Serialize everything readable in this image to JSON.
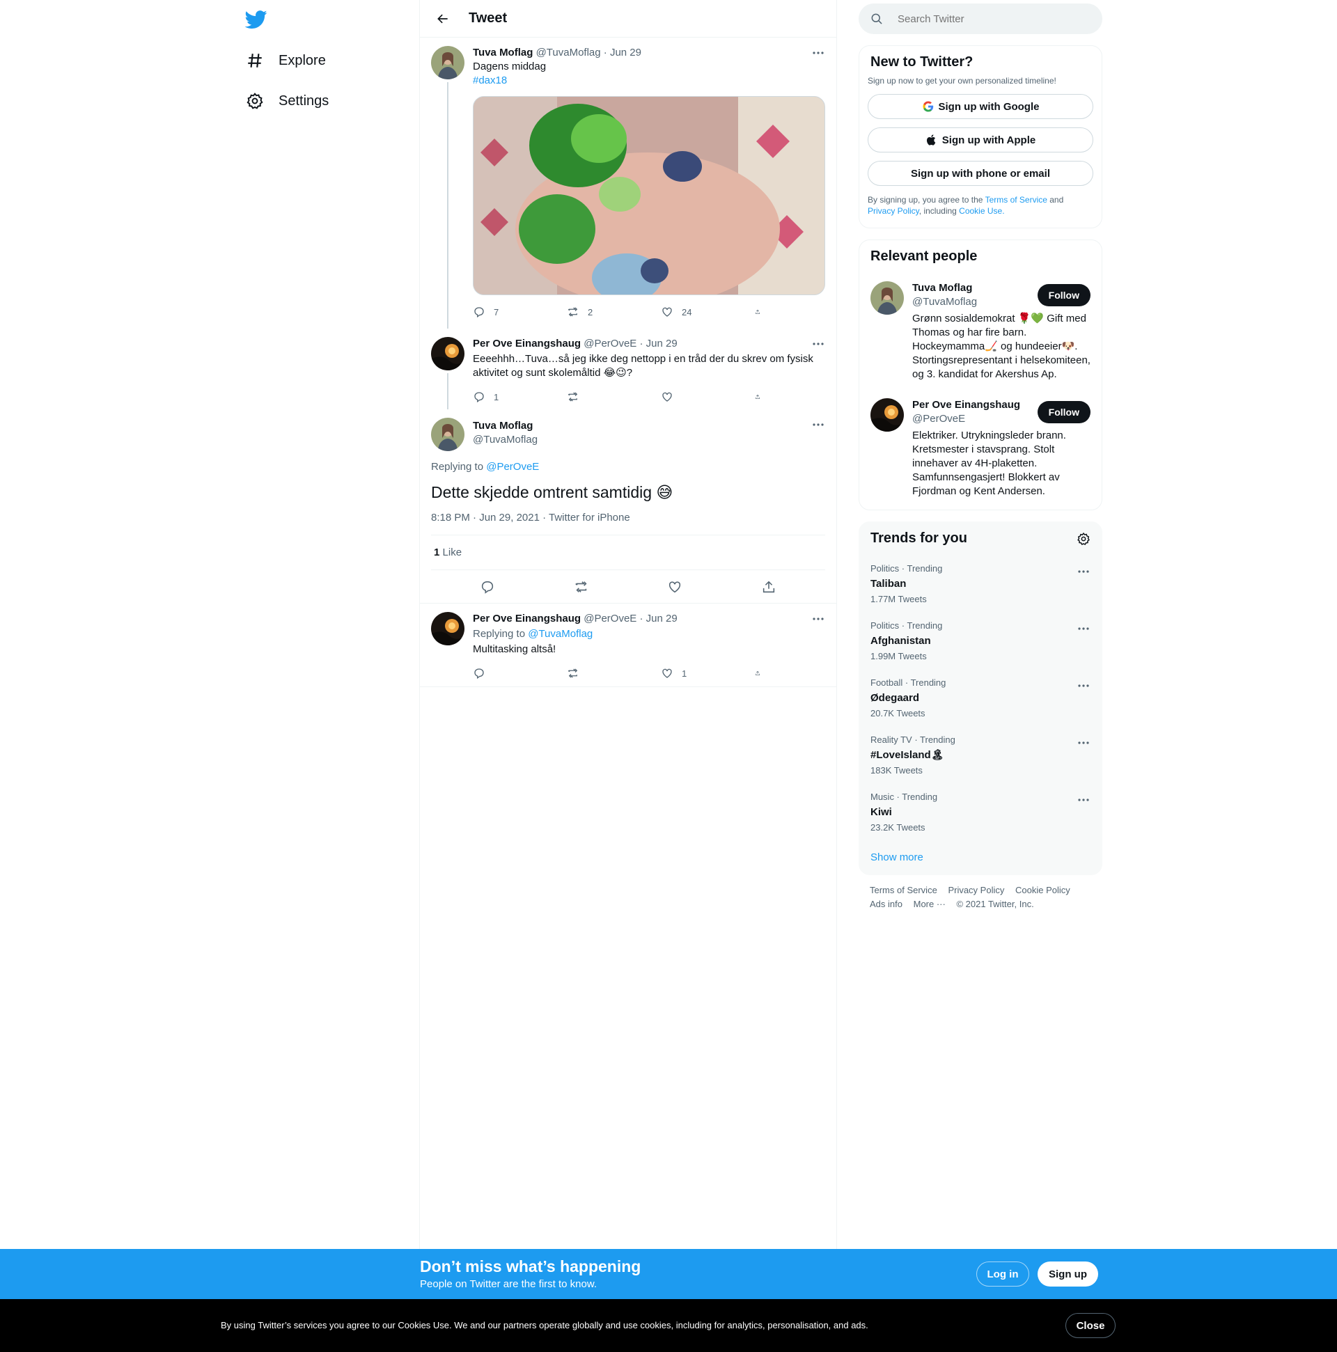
{
  "nav": {
    "logo": "twitter-bird-icon",
    "items": [
      {
        "label": "Explore",
        "icon": "hashtag-icon"
      },
      {
        "label": "Settings",
        "icon": "gear-icon"
      }
    ]
  },
  "header": {
    "title": "Tweet"
  },
  "thread": [
    {
      "name": "Tuva Moflag",
      "handle": "@TuvaMoflag",
      "date": "· Jun 29",
      "text": "Dagens middag",
      "hashtag": "#dax18",
      "replies": "7",
      "retweets": "2",
      "likes": "24"
    },
    {
      "name": "Per Ove Einangshaug",
      "handle": "@PerOveE",
      "date": "· Jun 29",
      "text": "Eeeehhh…Tuva…så jeg ikke deg nettopp i en tråd der du skrev om fysisk aktivitet og sunt skolemåltid 😂😉?",
      "replies": "1",
      "retweets": "",
      "likes": ""
    }
  ],
  "focal": {
    "name": "Tuva Moflag",
    "handle": "@TuvaMoflag",
    "replying_label": "Replying to",
    "replying_to": "@PerOveE",
    "text": "Dette skjedde omtrent samtidig 😅",
    "meta": "8:18 PM · Jun 29, 2021 · Twitter for iPhone",
    "like_count": "1",
    "like_label": "Like"
  },
  "reply": {
    "name": "Per Ove Einangshaug",
    "handle": "@PerOveE",
    "date": "· Jun 29",
    "replying_label": "Replying to",
    "replying_to": "@TuvaMoflag",
    "text": "Multitasking altså!",
    "replies": "",
    "retweets": "",
    "likes": "1"
  },
  "search": {
    "placeholder": "Search Twitter"
  },
  "new_to_twitter": {
    "title": "New to Twitter?",
    "subtitle": "Sign up now to get your own personalized timeline!",
    "google": "Sign up with Google",
    "apple": "Sign up with Apple",
    "phone": "Sign up with phone or email",
    "legal_1": "By signing up, you agree to the ",
    "terms": "Terms of Service",
    "legal_2": " and ",
    "privacy": "Privacy Policy",
    "legal_3": ", including ",
    "cookie": "Cookie Use."
  },
  "relevant": {
    "title": "Relevant people",
    "follow_label": "Follow",
    "people": [
      {
        "name": "Tuva Moflag",
        "handle": "@TuvaMoflag",
        "bio": "Grønn sosialdemokrat 🌹💚 Gift med Thomas og har fire barn. Hockeymamma🏒 og hundeeier🐶. Stortingsrepresentant i helsekomiteen, og 3. kandidat for Akershus Ap."
      },
      {
        "name": "Per Ove Einangshaug",
        "handle": "@PerOveE",
        "bio": "Elektriker. Utrykningsleder brann. Kretsmester i stavsprang. Stolt innehaver av 4H-plaketten. Samfunnsengasjert! Blokkert av Fjordman og Kent Andersen."
      }
    ]
  },
  "trends": {
    "title": "Trends for you",
    "items": [
      {
        "context": "Politics · Trending",
        "name": "Taliban",
        "count": "1.77M Tweets"
      },
      {
        "context": "Politics · Trending",
        "name": "Afghanistan",
        "count": "1.99M Tweets"
      },
      {
        "context": "Football · Trending",
        "name": "Ødegaard",
        "count": "20.7K Tweets"
      },
      {
        "context": "Reality TV · Trending",
        "name": "#LoveIsland🏝",
        "count": "183K Tweets"
      },
      {
        "context": "Music · Trending",
        "name": "Kiwi",
        "count": "23.2K Tweets"
      }
    ],
    "show_more": "Show more"
  },
  "footer": {
    "terms": "Terms of Service",
    "privacy": "Privacy Policy",
    "cookie": "Cookie Policy",
    "ads": "Ads info",
    "more": "More ···",
    "copyright": "© 2021 Twitter, Inc."
  },
  "bottom_bar": {
    "title": "Don’t miss what’s happening",
    "subtitle": "People on Twitter are the first to know.",
    "login": "Log in",
    "signup": "Sign up"
  },
  "cookie_bar": {
    "text": "By using Twitter’s services you agree to our Cookies Use. We and our partners operate globally and use cookies, including for analytics, personalisation, and ads.",
    "close": "Close"
  },
  "colors": {
    "accent": "#1d9bf0",
    "text": "#0f1419",
    "muted": "#536471",
    "border": "#eff3f4"
  }
}
